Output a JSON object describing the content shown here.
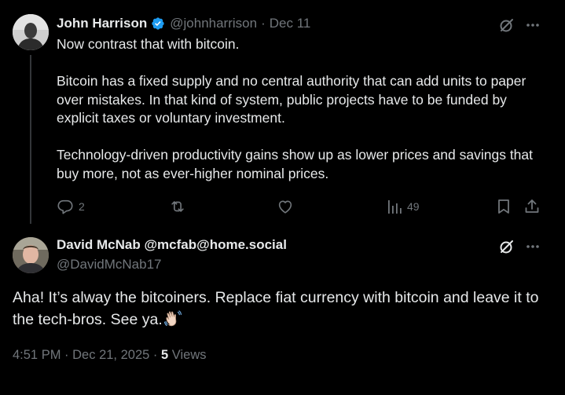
{
  "colors": {
    "background": "#000000",
    "text_primary": "#e7e9ea",
    "text_secondary": "#71767b",
    "verified_badge": "#1d9bf0",
    "thread_line": "#333639"
  },
  "reply_tweet": {
    "display_name": "John Harrison",
    "verified": true,
    "handle": "@johnharrison",
    "separator": "·",
    "date": "Dec 11",
    "paragraphs": [
      "Now contrast that with bitcoin.",
      "Bitcoin has a fixed supply and no central authority that can add units to paper over mistakes. In that kind of system, public projects have to be funded by explicit taxes or voluntary investment.",
      "Technology-driven productivity gains show up as lower prices and savings that buy more, not as ever-higher nominal prices."
    ],
    "actions": {
      "reply_count": "2",
      "retweet_count": "",
      "like_count": "",
      "views_count": "49"
    },
    "icons": [
      "grok-icon",
      "more-icon",
      "reply-icon",
      "retweet-icon",
      "like-icon",
      "views-icon",
      "bookmark-icon",
      "share-icon"
    ]
  },
  "main_tweet": {
    "display_name": "David McNab @mcfab@home.social",
    "handle": "@DavidMcNab17",
    "text": "Aha! It’s alway the bitcoiners. Replace fiat currency with bitcoin and leave it to the tech-bros. See ya.",
    "emoji": "waving-hand-emoji",
    "time": "4:51 PM",
    "separator": "·",
    "date": "Dec 21, 2025",
    "views_count": "5",
    "views_label": "Views",
    "icons": [
      "grok-icon",
      "more-icon"
    ]
  }
}
